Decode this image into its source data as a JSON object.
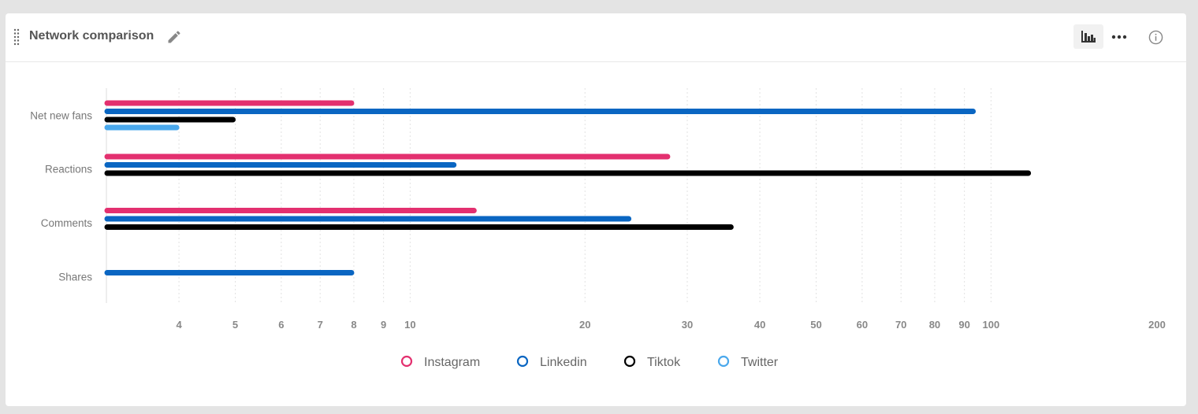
{
  "header": {
    "title": "Network comparison",
    "icons": [
      "drag-handle-icon",
      "pencil-icon",
      "bar-chart-icon",
      "more-icon",
      "info-icon"
    ]
  },
  "chart_data": {
    "type": "bar",
    "orientation": "horizontal",
    "x_scale": "log",
    "xlim": [
      3,
      200
    ],
    "grid": true,
    "legend_position": "bottom",
    "categories": [
      "Net new fans",
      "Reactions",
      "Comments",
      "Shares"
    ],
    "x_ticks": [
      "4",
      "5",
      "6",
      "7",
      "8",
      "9",
      "10",
      "20",
      "30",
      "40",
      "50",
      "60",
      "70",
      "80",
      "90",
      "100",
      "200"
    ],
    "series": [
      {
        "name": "Instagram",
        "color": "#e3306f",
        "values": [
          8,
          28,
          13,
          null
        ]
      },
      {
        "name": "Linkedin",
        "color": "#0a66c2",
        "values": [
          94,
          12,
          24,
          8
        ]
      },
      {
        "name": "Tiktok",
        "color": "#000000",
        "values": [
          5,
          117,
          36,
          null
        ]
      },
      {
        "name": "Twitter",
        "color": "#4aa8ec",
        "values": [
          4,
          null,
          null,
          null
        ]
      }
    ]
  }
}
